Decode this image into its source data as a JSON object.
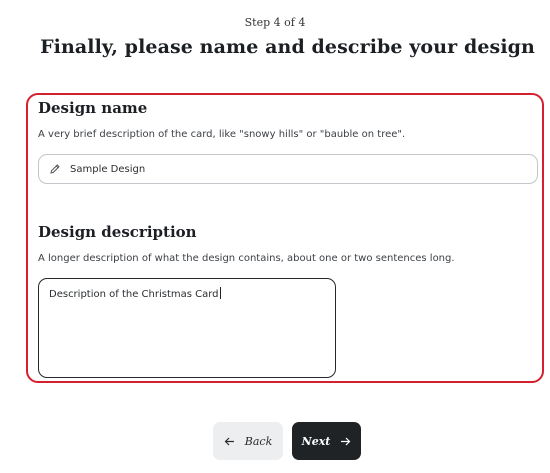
{
  "step": "Step 4 of 4",
  "title": "Finally, please name and describe your design",
  "name_section": {
    "label": "Design name",
    "help": "A very brief description of the card, like \"snowy hills\" or \"bauble on tree\".",
    "value": "Sample Design",
    "icon": "pencil-icon"
  },
  "description_section": {
    "label": "Design description",
    "help": "A longer description of what the design contains, about one or two sentences long.",
    "value": "Description of the Christmas Card"
  },
  "buttons": {
    "back_label": "Back",
    "next_label": "Next",
    "back_icon": "arrow-left-icon",
    "next_icon": "arrow-right-icon"
  },
  "colors": {
    "highlight_border": "#d5202f",
    "primary_button": "#1f2326",
    "secondary_button": "#eceeef"
  }
}
